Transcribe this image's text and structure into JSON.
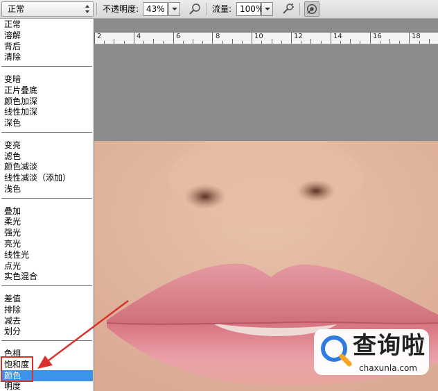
{
  "toolbar": {
    "mode_value": "正常",
    "opacity_label": "不透明度:",
    "opacity_value": "43%",
    "flow_label": "流量:",
    "flow_value": "100%"
  },
  "ruler": {
    "labels": [
      "2",
      "4",
      "6",
      "8",
      "10",
      "12",
      "14",
      "16",
      "18"
    ]
  },
  "blend_modes": {
    "groups": [
      [
        "正常",
        "溶解",
        "背后",
        "清除"
      ],
      [
        "变暗",
        "正片叠底",
        "颜色加深",
        "线性加深",
        "深色"
      ],
      [
        "变亮",
        "滤色",
        "颜色减淡",
        "线性减淡（添加）",
        "浅色"
      ],
      [
        "叠加",
        "柔光",
        "强光",
        "亮光",
        "线性光",
        "点光",
        "实色混合"
      ],
      [
        "差值",
        "排除",
        "减去",
        "划分"
      ],
      [
        "色相",
        "饱和度",
        "颜色",
        "明度"
      ]
    ],
    "selected": "颜色"
  },
  "watermark": {
    "title": "查询啦",
    "url": "chaxunla.com"
  },
  "colors": {
    "selection": "#3d93e8",
    "annotation_red": "#d8322c"
  },
  "icons": [
    "chevron-updown-icon",
    "dropdown-arrow-icon",
    "airbrush-pressure-icon",
    "airbrush-icon",
    "tablet-pressure-size-icon",
    "magnifier-q-logo-icon",
    "annotation-arrow-icon"
  ]
}
